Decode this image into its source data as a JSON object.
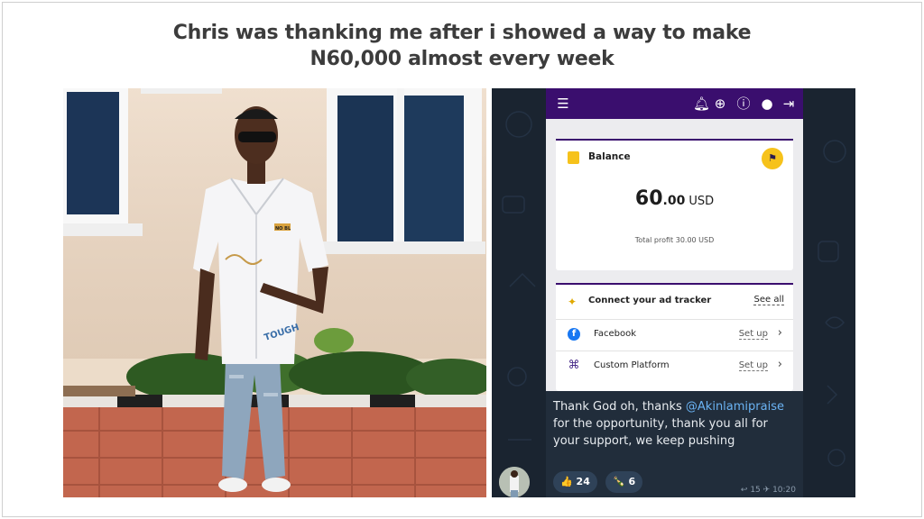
{
  "headline": {
    "line1": "Chris was thanking me after i showed a way to make",
    "line2": "N60,000 almost every week"
  },
  "photo": {
    "shirt_patch": "NO BL",
    "shirt_text": "TOUGH"
  },
  "app": {
    "header_icons": [
      "menu-icon",
      "bell-icon",
      "globe-icon",
      "help-icon",
      "user-icon",
      "logout-icon"
    ],
    "balance": {
      "label": "Balance",
      "amount_int": "60",
      "amount_dec": ".00",
      "currency": "USD",
      "profit_text": "Total profit 30.00 USD"
    },
    "tracker": {
      "title": "Connect your ad tracker",
      "see_all": "See all",
      "rows": [
        {
          "label": "Facebook",
          "action": "Set up",
          "icon": "facebook-icon"
        },
        {
          "label": "Custom Platform",
          "action": "Set up",
          "icon": "custom-platform-icon"
        }
      ]
    }
  },
  "message": {
    "text_before": "Thank God oh, thanks",
    "mention": "@Akinlamipraise",
    "text_after": "for the opportunity, thank you all for your support, we keep pushing",
    "reactions": [
      {
        "emoji": "👍",
        "count": "24"
      },
      {
        "emoji": "🍾",
        "count": "6"
      }
    ],
    "replies": "15",
    "time": "10:20"
  },
  "colors": {
    "app_header": "#3a0e6e",
    "accent_yellow": "#f6c21b",
    "chat_bg": "#1a2430",
    "bubble_bg": "#212d3b",
    "mention": "#6ab3f3"
  }
}
